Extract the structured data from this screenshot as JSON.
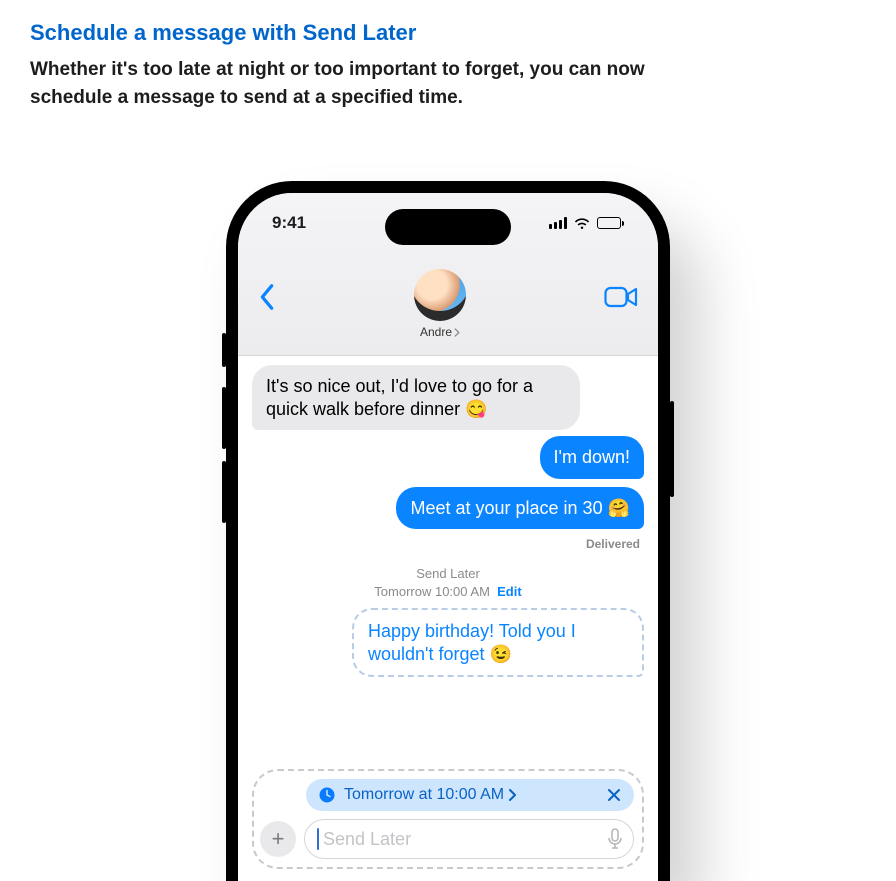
{
  "header": {
    "title": "Schedule a message with Send Later",
    "body": "Whether it's too late at night or too important to forget, you can now schedule a message to send at a specified time."
  },
  "phone": {
    "status": {
      "time": "9:41"
    },
    "contact": {
      "name": "Andre"
    },
    "messages": {
      "incoming_1": "It's so nice out, I'd love to go for a quick walk before dinner 😋",
      "outgoing_1": "I'm down!",
      "outgoing_2": "Meet at your place in 30 🤗",
      "delivered": "Delivered",
      "sched_label": "Send Later",
      "sched_time": "Tomorrow 10:00 AM",
      "sched_edit": "Edit",
      "scheduled_body": "Happy birthday! Told you I wouldn't forget 😉"
    },
    "compose": {
      "chip": "Tomorrow at 10:00 AM",
      "placeholder": "Send Later"
    }
  }
}
